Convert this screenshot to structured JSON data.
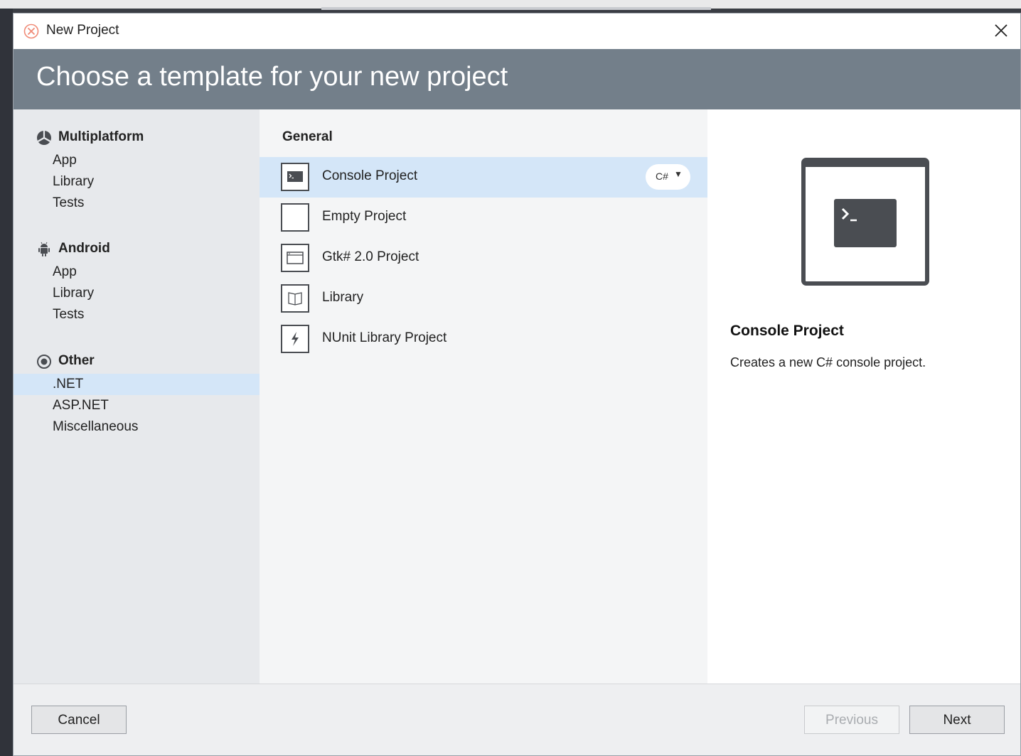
{
  "window": {
    "title": "New Project"
  },
  "header": {
    "title": "Choose a template for your new project"
  },
  "sidebar": {
    "categories": [
      {
        "label": "Multiplatform",
        "icon": "multiplatform-icon",
        "items": [
          "App",
          "Library",
          "Tests"
        ]
      },
      {
        "label": "Android",
        "icon": "android-icon",
        "items": [
          "App",
          "Library",
          "Tests"
        ]
      },
      {
        "label": "Other",
        "icon": "other-icon",
        "items": [
          ".NET",
          "ASP.NET",
          "Miscellaneous"
        ]
      }
    ],
    "selected": ".NET"
  },
  "templates": {
    "section": "General",
    "items": [
      {
        "label": "Console Project",
        "icon": "console-icon"
      },
      {
        "label": "Empty Project",
        "icon": "empty-project-icon"
      },
      {
        "label": "Gtk# 2.0 Project",
        "icon": "gtk-window-icon"
      },
      {
        "label": "Library",
        "icon": "library-icon"
      },
      {
        "label": "NUnit Library Project",
        "icon": "nunit-icon"
      }
    ],
    "selected": "Console Project",
    "language": "C#"
  },
  "preview": {
    "title": "Console Project",
    "description": "Creates a new C# console project.",
    "icon_glyph": "❯_"
  },
  "footer": {
    "cancel_label": "Cancel",
    "previous_label": "Previous",
    "next_label": "Next"
  },
  "colors": {
    "header_bg": "#737f8a",
    "selection_bg": "#d4e6f8",
    "sidebar_bg": "#e7e9ec",
    "app_icon_accent": "#f08a76"
  }
}
